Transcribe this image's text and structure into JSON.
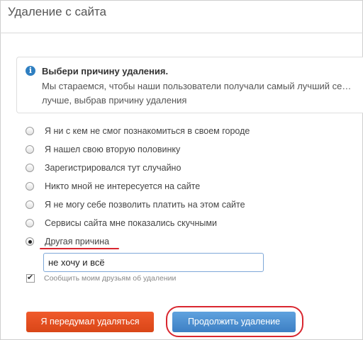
{
  "header": {
    "title": "Удаление с сайта"
  },
  "info": {
    "icon": "info-icon",
    "title": "Выбери причину удаления.",
    "text": "Мы стараемся, чтобы наши пользователи получали самый лучший се… лучше, выбрав причину удаления"
  },
  "reasons": [
    {
      "label": "Я ни с кем не смог познакомиться в своем городе",
      "checked": false
    },
    {
      "label": "Я нашел свою вторую половинку",
      "checked": false
    },
    {
      "label": "Зарегистрировался тут случайно",
      "checked": false
    },
    {
      "label": "Никто мной не интересуется на сайте",
      "checked": false
    },
    {
      "label": "Я не могу себе позволить платить на этом сайте",
      "checked": false
    },
    {
      "label": "Сервисы сайта мне показались скучными",
      "checked": false
    },
    {
      "label": "Другая причина",
      "checked": true
    }
  ],
  "other_reason": {
    "value": "не хочу и всё"
  },
  "notify_friends": {
    "label": "Сообщить моим друзьям об удалении",
    "checked": true
  },
  "buttons": {
    "cancel_label": "Я передумал удаляться",
    "continue_label": "Продолжить удаление"
  },
  "colors": {
    "cancel_button": "#e84e1f",
    "continue_button": "#4a8fd4",
    "annotation_red": "#d9262f",
    "info_icon": "#2f7fc1"
  }
}
